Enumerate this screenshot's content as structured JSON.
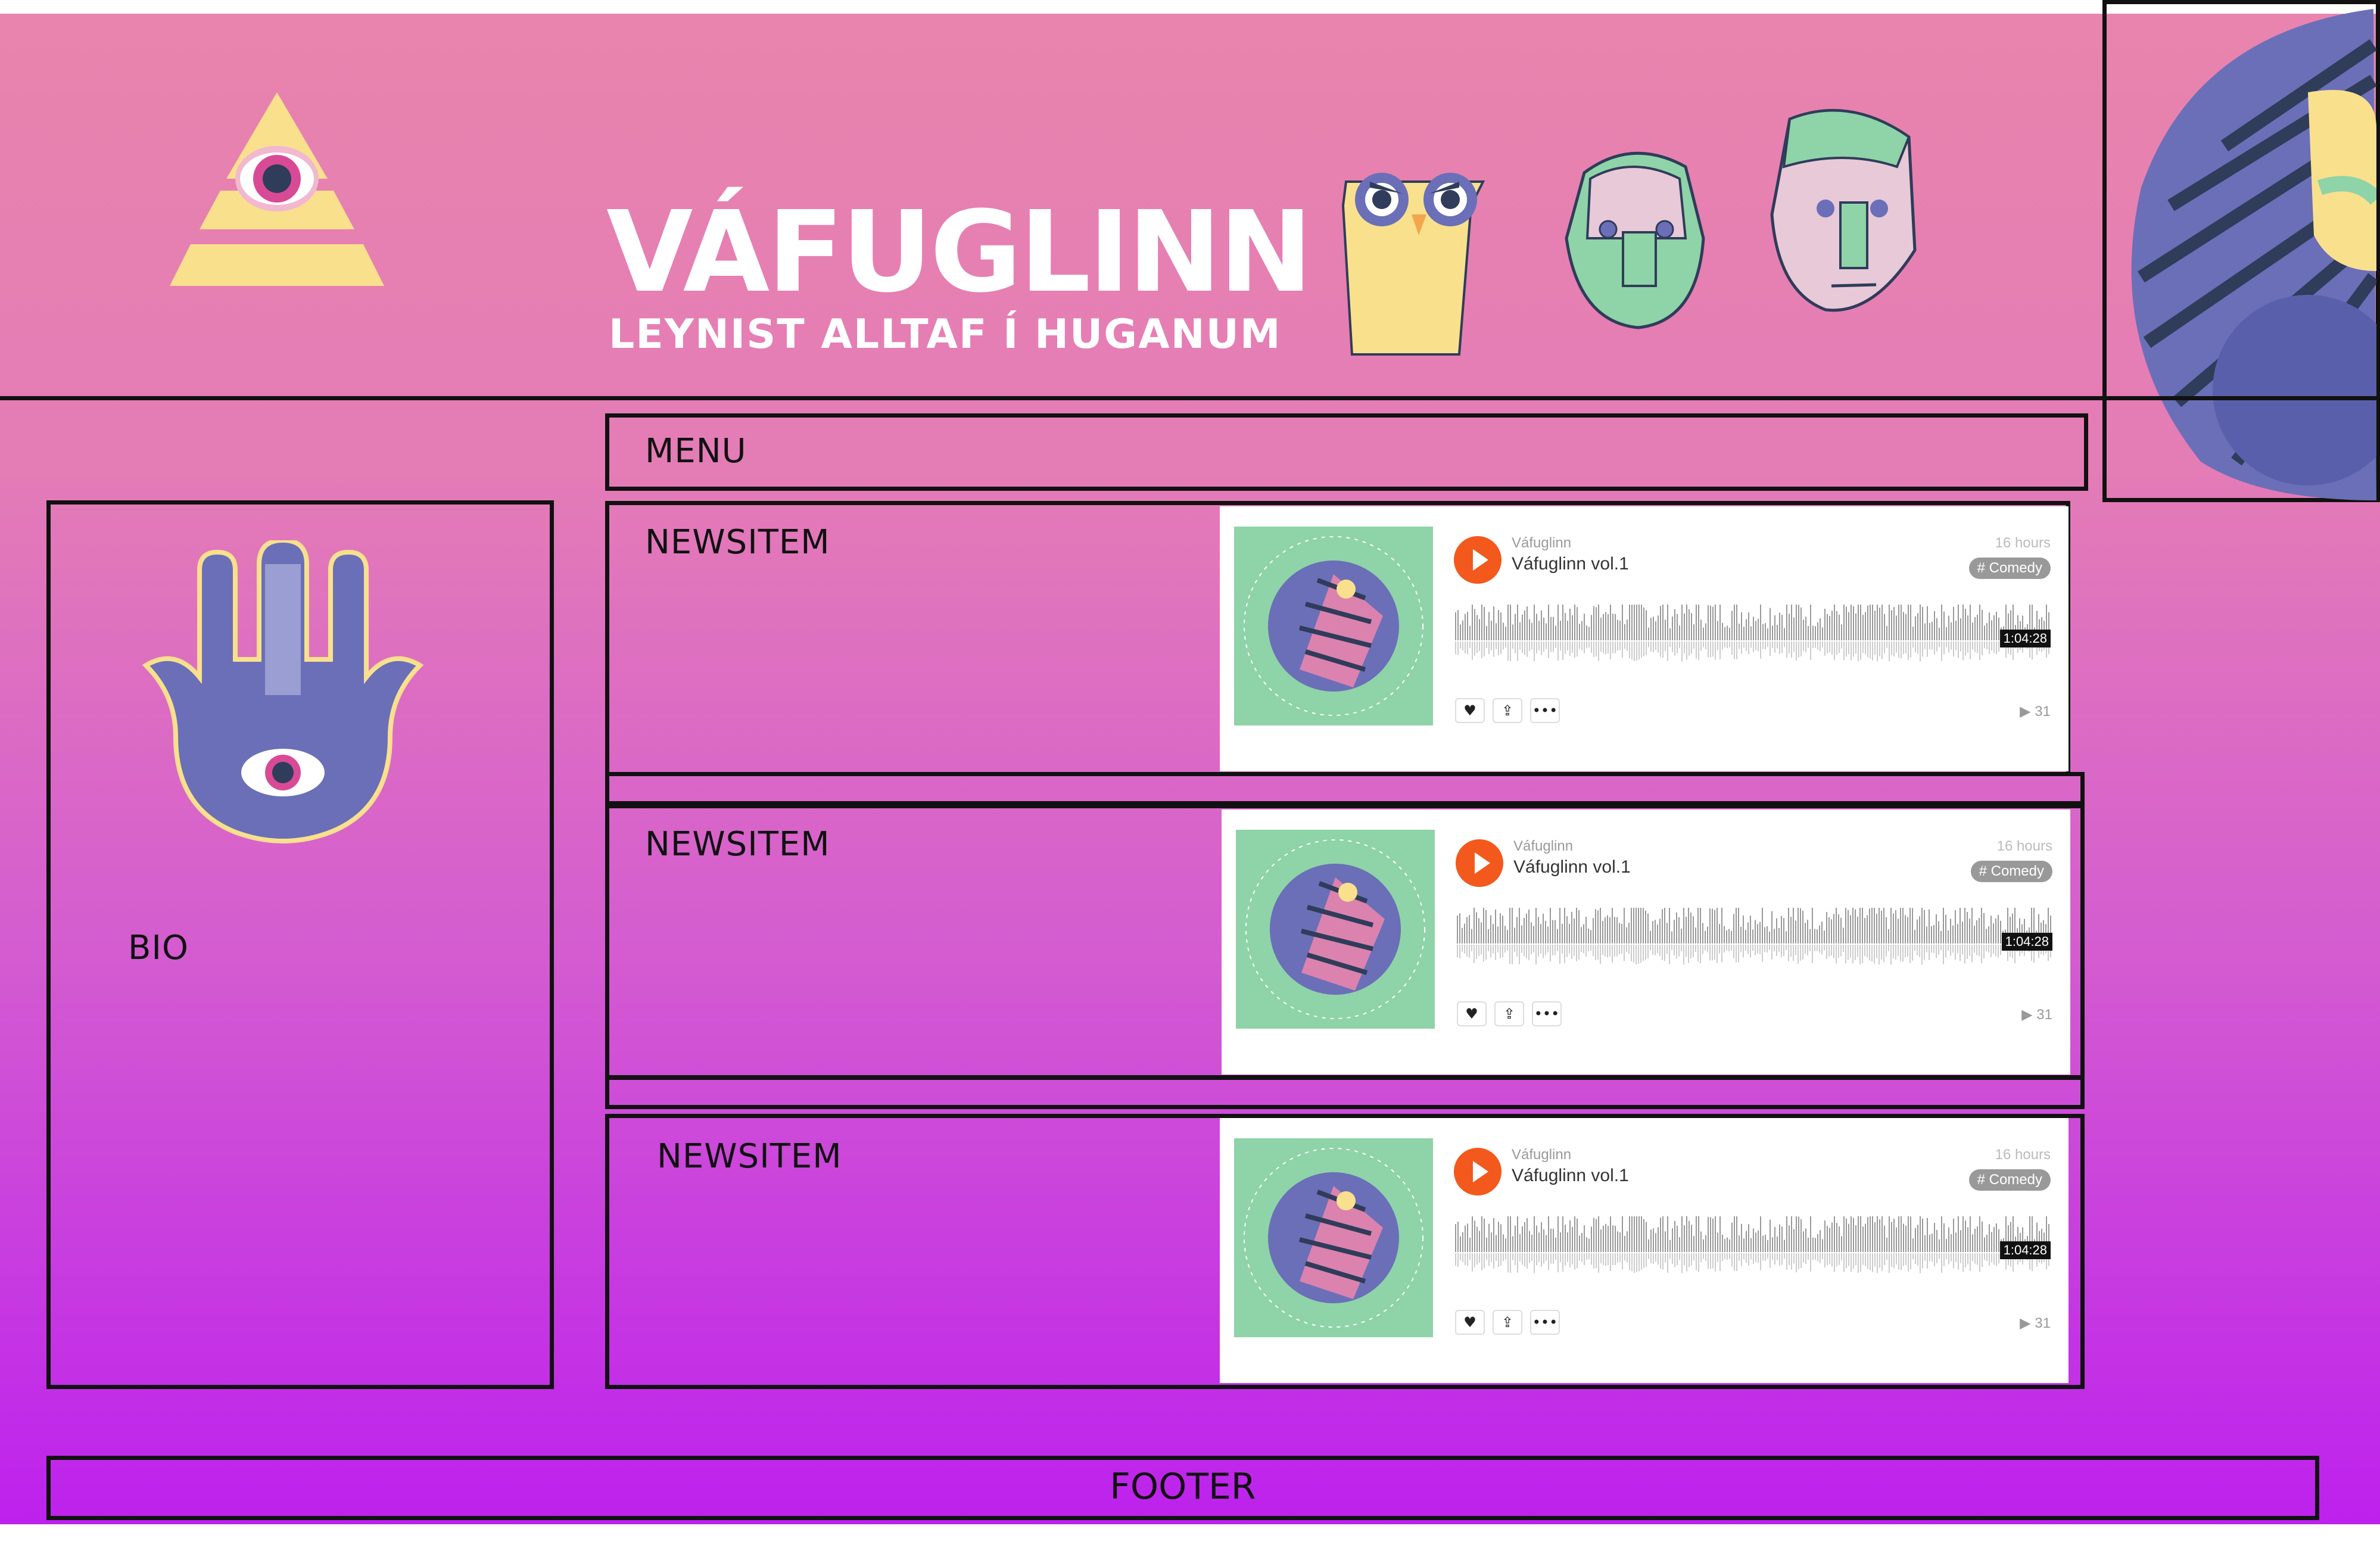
{
  "brand": {
    "title": "VÁFUGLINN",
    "subtitle": "LEYNIST ALLTAF Í HUGANUM",
    "colors": {
      "pink": "#e884ad",
      "purple": "#bd21ed",
      "yellow": "#f9e08d",
      "indigo": "#6a6fb8",
      "green": "#8fd3a8"
    }
  },
  "menu": {
    "label": "MENU"
  },
  "sidebar": {
    "bio_label": "BIO"
  },
  "news": {
    "items": [
      {
        "label": "NEWSITEM"
      },
      {
        "label": "NEWSITEM"
      },
      {
        "label": "NEWSITEM"
      }
    ]
  },
  "player": {
    "artist": "Váfuglinn",
    "track": "Váfuglinn vol.1",
    "time_ago": "16 hours",
    "tag": "# Comedy",
    "duration": "1:04:28",
    "plays": "▶ 31",
    "icons": [
      "play-icon",
      "heart-icon",
      "share-icon",
      "more-icon"
    ]
  },
  "footer": {
    "label": "FOOTER"
  }
}
